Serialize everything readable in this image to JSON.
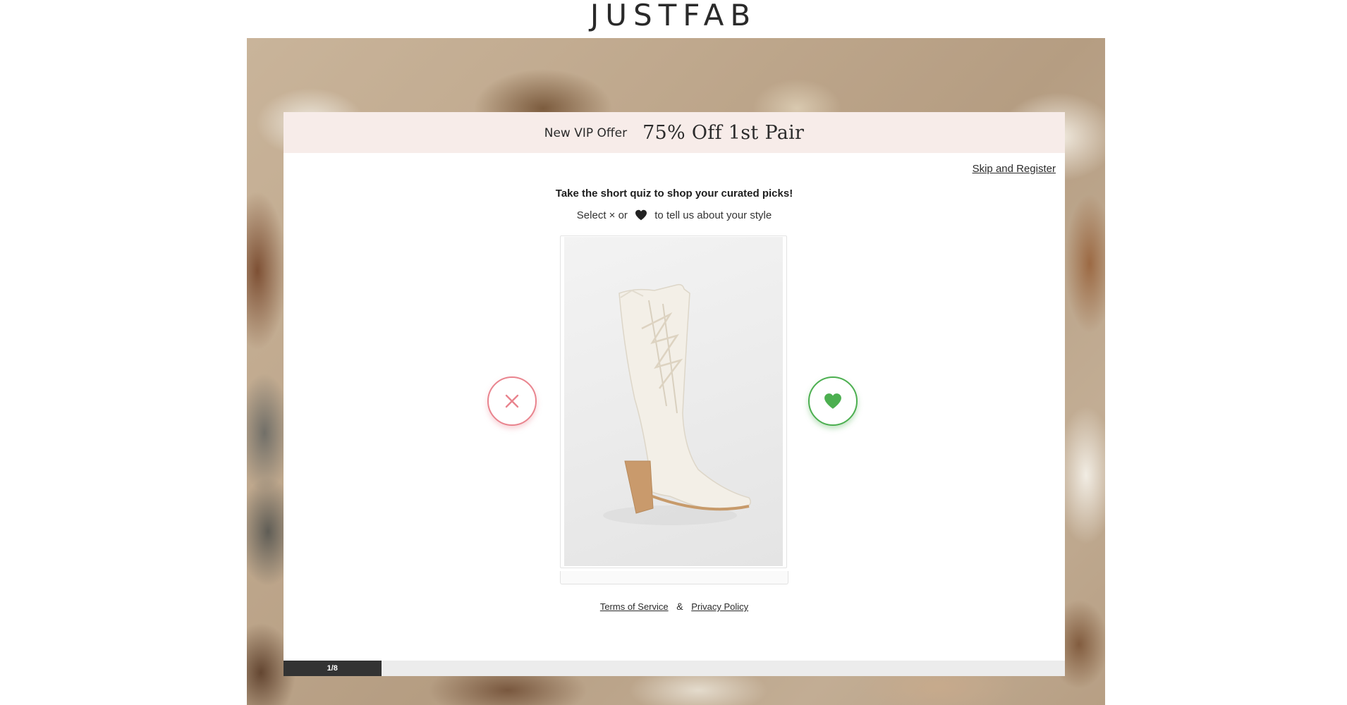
{
  "brand": {
    "logo_text": "JUSTFAB"
  },
  "banner": {
    "label": "New VIP Offer",
    "offer": "75% Off 1st Pair",
    "background": "#f7ece9"
  },
  "quiz": {
    "skip_label": "Skip and Register",
    "heading": "Take the short quiz to shop your curated picks!",
    "instruction_prefix": "Select × or",
    "instruction_suffix": "to tell us about your style",
    "item_image_icon": "white-western-cowboy-boot",
    "dislike_icon": "close-icon",
    "like_icon": "heart-icon",
    "dislike_color": "#e9848e",
    "like_color": "#4caf50"
  },
  "legal": {
    "terms_label": "Terms of Service",
    "separator": "&",
    "privacy_label": "Privacy Policy"
  },
  "progress": {
    "label": "1/8",
    "current": 1,
    "total": 8,
    "fraction": 0.125,
    "fill_color": "#333333"
  }
}
